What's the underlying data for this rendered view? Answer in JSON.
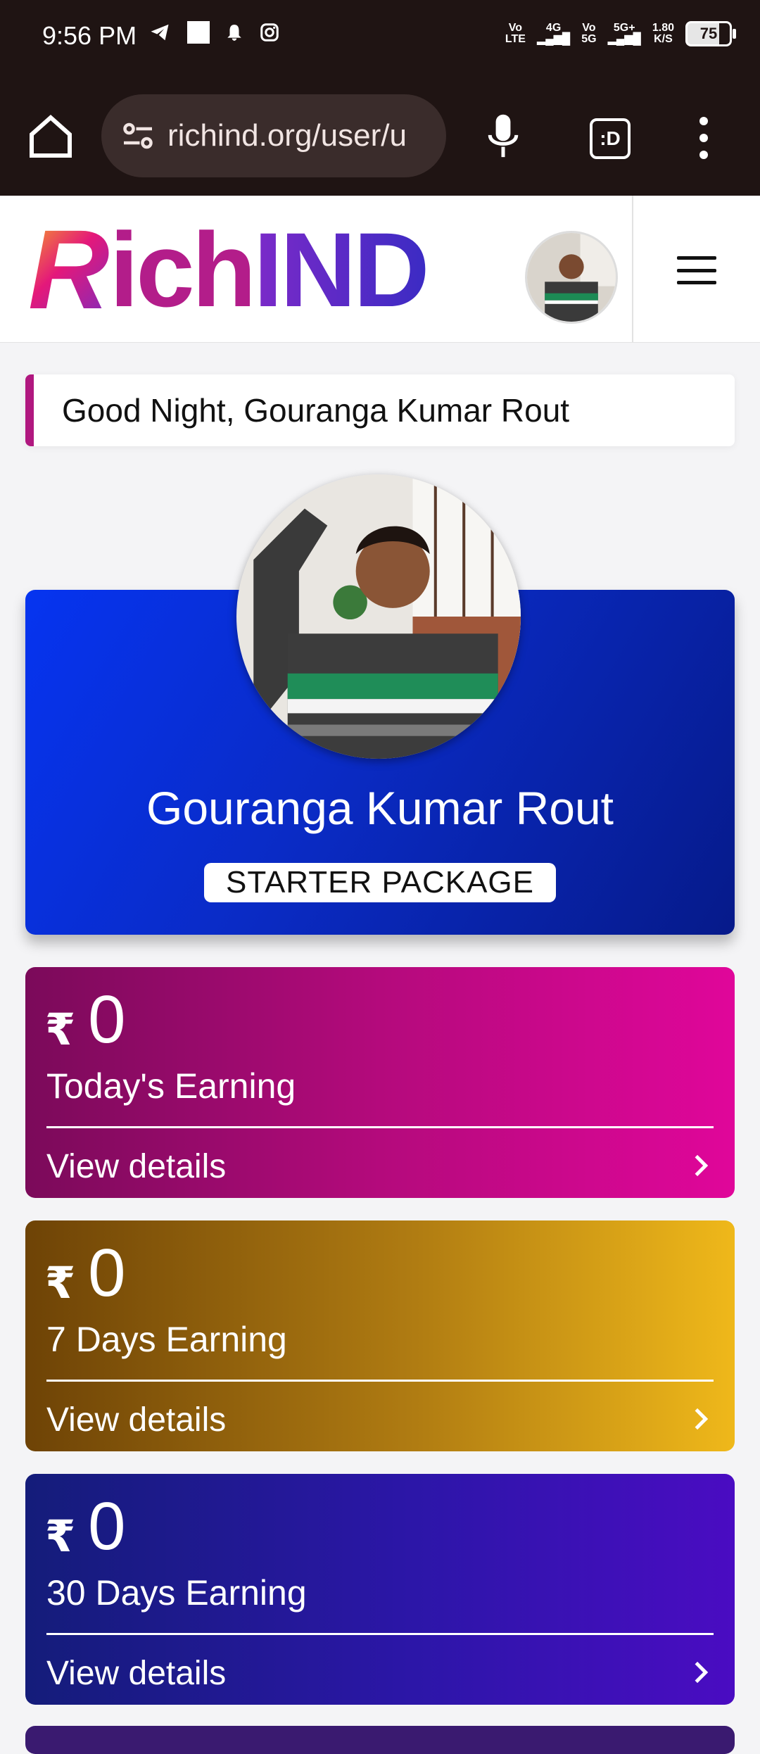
{
  "status_bar": {
    "time": "9:56 PM",
    "volte1_top": "Vo",
    "volte1_bottom": "LTE",
    "net1": "4G",
    "volte2_top": "Vo",
    "volte2_bottom": "5G",
    "net2": "5G+",
    "speed_top": "1.80",
    "speed_bottom": "K/S",
    "battery": "75",
    "icons": [
      "telegram-icon",
      "square-notification-icon",
      "bell-icon",
      "instagram-icon",
      "signal-icon",
      "battery-icon"
    ]
  },
  "browser": {
    "url": "richind.org/user/u",
    "tabs_label": ":D",
    "icons": [
      "home-icon",
      "site-settings-icon",
      "mic-icon",
      "tabs-icon",
      "more-vert-icon"
    ]
  },
  "site": {
    "logo_r": "R",
    "logo_ich": "ich",
    "logo_ind": "IND",
    "menu_icon": "hamburger-icon"
  },
  "greeting": "Good Night, Gouranga Kumar Rout",
  "profile": {
    "name": "Gouranga Kumar Rout",
    "package": "STARTER PACKAGE"
  },
  "earnings": [
    {
      "currency": "₹",
      "amount": "0",
      "label": "Today's Earning",
      "link": "View details",
      "color": "#b40a7c"
    },
    {
      "currency": "₹",
      "amount": "0",
      "label": "7 Days Earning",
      "link": "View details",
      "color": "#b07c12"
    },
    {
      "currency": "₹",
      "amount": "0",
      "label": "30 Days Earning",
      "link": "View details",
      "color": "#2c16a8"
    }
  ],
  "colors": {
    "status_bg": "#1f1413",
    "accent": "#b0177f",
    "profile_blue": "#0634f0"
  }
}
